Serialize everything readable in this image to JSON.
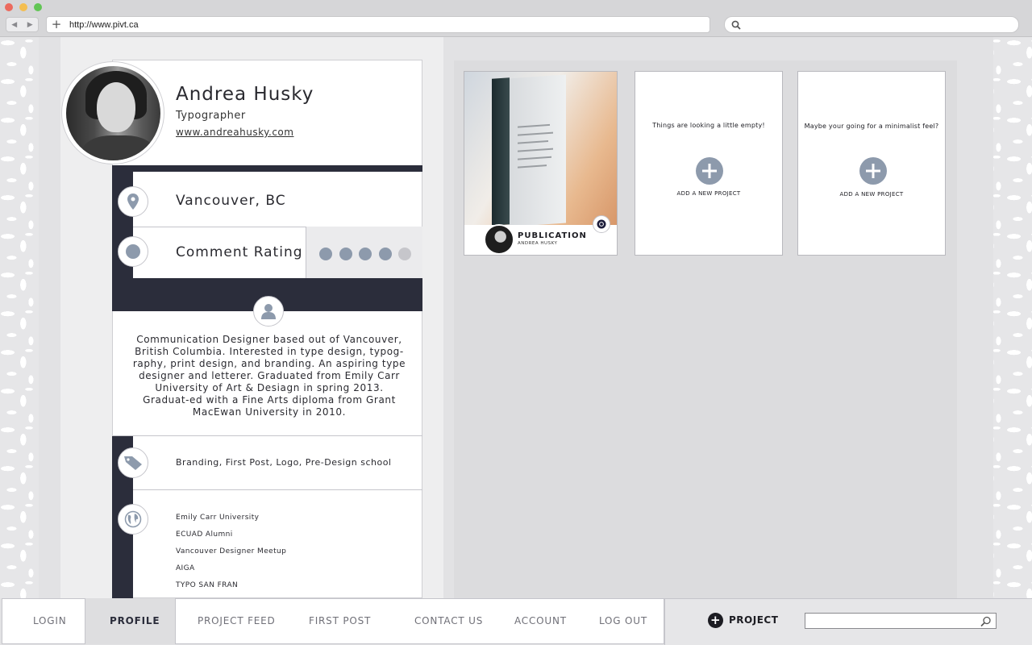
{
  "browser": {
    "url": "http://www.pivt.ca",
    "back_glyph": "◀",
    "forward_glyph": "▶",
    "new_tab_glyph": "+"
  },
  "profile": {
    "name": "Andrea Husky",
    "role": "Typographer",
    "website": "www.andreahusky.com",
    "location": "Vancouver, BC",
    "rating_label": "Comment Rating",
    "rating": {
      "filled": 4,
      "total": 5
    },
    "bio": "Communication Designer based out of Vancouver, British Columbia. Interested in type design, typog-raphy, print design, and branding. An aspiring type designer and letterer. Graduated from Emily Carr University of Art & Desiagn in spring 2013. Graduat-ed with a Fine Arts diploma from Grant MacEwan University in 2010.",
    "tags": "Branding, First Post, Logo, Pre-Design school",
    "groups": [
      "Emily Carr University",
      "ECUAD Alumni",
      "Vancouver Designer Meetup",
      "AIGA",
      "TYPO SAN FRAN"
    ]
  },
  "projects": [
    {
      "title": "PUBLICATION",
      "author": "ANDREA HUSKY"
    }
  ],
  "empty_slots": [
    {
      "message": "Things are looking a little empty!",
      "add_label": "ADD A NEW PROJECT"
    },
    {
      "message": "Maybe your going for a minimalist feel?",
      "add_label": "ADD A NEW PROJECT"
    }
  ],
  "nav": {
    "items": [
      "LOGIN",
      "PROFILE",
      "PROJECT FEED",
      "FIRST POST",
      "CONTACT US",
      "ACCOUNT",
      "LOG OUT"
    ],
    "active": "PROFILE",
    "add_project_label": "PROJECT",
    "search_value": ""
  },
  "colors": {
    "dark_navy": "#2b2d3b",
    "icon_blue_gray": "#8d9aac",
    "rating_filled": "#8d9aac",
    "rating_empty": "#c6c6cb"
  },
  "icons": [
    "location-pin-icon",
    "rating-icon",
    "person-icon",
    "tag-icon",
    "globe-icon",
    "comment-icon",
    "add-icon",
    "search-icon"
  ]
}
